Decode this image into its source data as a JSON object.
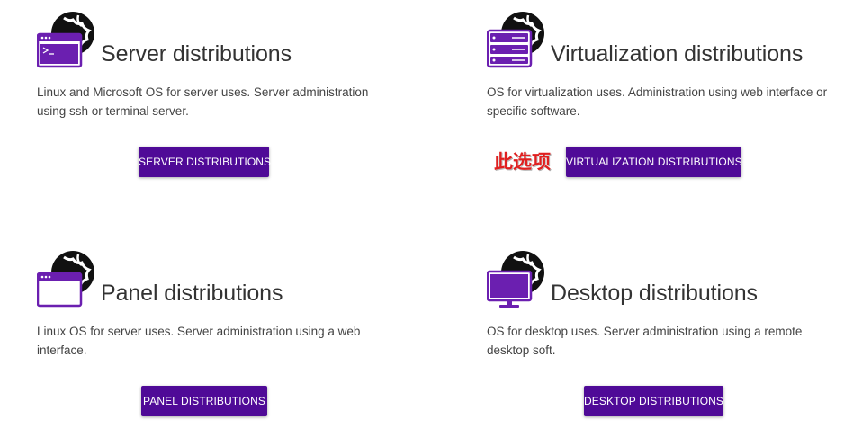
{
  "cards": [
    {
      "title": "Server distributions",
      "description": "Linux and Microsoft OS for server uses. Server administration using ssh or terminal server.",
      "button": "SERVER DISTRIBUTIONS",
      "icon": "terminal-window-globe-icon"
    },
    {
      "title": "Virtualization distributions",
      "description": "OS for virtualization uses. Administration using web interface or specific software.",
      "button": "VIRTUALIZATION DISTRIBUTIONS",
      "icon": "server-rack-globe-icon"
    },
    {
      "title": "Panel distributions",
      "description": "Linux OS for server uses. Server administration using a web interface.",
      "button": "PANEL DISTRIBUTIONS",
      "icon": "browser-window-globe-icon"
    },
    {
      "title": "Desktop distributions",
      "description": "OS for desktop uses. Server administration using a remote desktop soft.",
      "button": "DESKTOP DISTRIBUTIONS",
      "icon": "monitor-globe-icon"
    }
  ],
  "annotation": "此选项",
  "colors": {
    "accent": "#4f0a97",
    "icon_purple": "#6b1fb0",
    "globe": "#111111",
    "annotation": "#e02020"
  }
}
